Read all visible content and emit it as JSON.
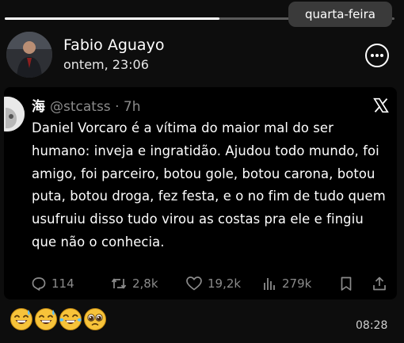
{
  "story": {
    "progress": 0.55,
    "day_label": "quarta-feira",
    "author_name": "Fabio Aguayo",
    "author_time": "ontem, 23:06"
  },
  "tweet": {
    "name_glyph": "海",
    "handle_time": "@stcatss · 7h",
    "text": "Daniel Vorcaro é a vítima do maior mal do ser humano: inveja e ingratidão. Ajudou todo mundo, foi amigo, foi parceiro, botou gole, botou carona, botou puta, botou droga, fez festa, e o no fim de tudo quem usufruiu disso tudo virou as costas pra ele e fingiu que não o conhecia.",
    "metrics": {
      "replies": "114",
      "reposts": "2,8k",
      "likes": "19,2k",
      "views": "279k"
    }
  },
  "reactions": [
    "grinning-sweat-emoji",
    "grinning-sweat-emoji",
    "tears-of-joy-emoji",
    "pleading-face-emoji"
  ],
  "message_time": "08:28",
  "colors": {
    "background": "#0d0d0d",
    "card": "#000000",
    "muted": "#8b8b8b",
    "pill": "#3a3a3a"
  }
}
